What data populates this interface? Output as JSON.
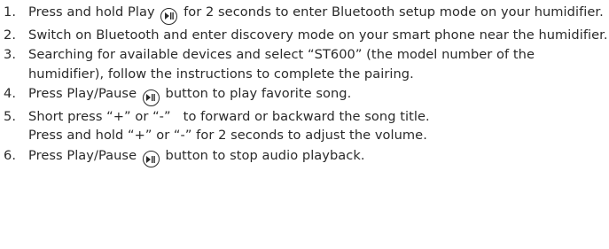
{
  "steps": [
    {
      "num": "1.",
      "before": "Press and hold Play",
      "icon": "play-pause-icon",
      "after": "for 2 seconds to enter Bluetooth setup mode on your humidifier."
    },
    {
      "num": "2.",
      "text": "Switch on Bluetooth and enter discovery mode on your smart phone near the humidifier."
    },
    {
      "num": "3.",
      "text": "Searching for available devices and select “ST600” (the model number of the humidifier), follow the instructions to complete the pairing."
    },
    {
      "num": "4.",
      "before": "Press Play/Pause",
      "icon": "play-pause-icon",
      "after": "button to play favorite song."
    },
    {
      "num": "5.",
      "line1": "Short press “+” or “-”   to forward or backward the song title.",
      "line2": "Press and hold “+” or “-” for 2 seconds to adjust the volume."
    },
    {
      "num": "6.",
      "before": "Press Play/Pause",
      "icon": "play-pause-icon",
      "after": "button to stop audio playback."
    }
  ],
  "colors": {
    "text": "#2a2a2a",
    "background": "#ffffff"
  }
}
